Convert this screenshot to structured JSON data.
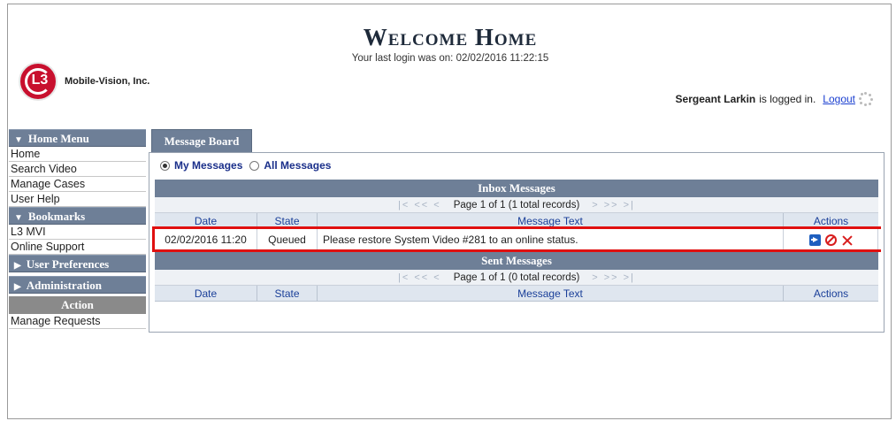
{
  "header": {
    "company": "Mobile-Vision, Inc.",
    "logo_text": "L3",
    "title": "Welcome Home",
    "last_login": "Your last login was on: 02/02/2016 11:22:15",
    "user_name": "Sergeant Larkin",
    "logged_in_suffix": "is logged in.",
    "logout_label": "Logout"
  },
  "sidebar": {
    "home_menu": {
      "title": "Home Menu",
      "items": [
        "Home",
        "Search Video",
        "Manage Cases",
        "User Help"
      ]
    },
    "bookmarks": {
      "title": "Bookmarks",
      "items": [
        "L3 MVI",
        "Online Support"
      ]
    },
    "user_preferences": "User Preferences",
    "administration": "Administration",
    "action": {
      "title": "Action",
      "items": [
        "Manage Requests"
      ]
    }
  },
  "main": {
    "tab_label": "Message Board",
    "filters": {
      "my_messages": "My Messages",
      "all_messages": "All Messages",
      "selected": "my_messages"
    },
    "inbox": {
      "title": "Inbox Messages",
      "pager_text": "Page 1 of 1 (1 total records)",
      "nav_prev": "|< << <",
      "nav_next": "> >> >|",
      "columns": [
        "Date",
        "State",
        "Message Text",
        "Actions"
      ],
      "rows": [
        {
          "date": "02/02/2016 11:20",
          "state": "Queued",
          "message": "Please restore System Video #281 to an online status.",
          "actions": [
            "forward-icon",
            "cancel-icon",
            "delete-icon"
          ]
        }
      ]
    },
    "sent": {
      "title": "Sent Messages",
      "pager_text": "Page 1 of 1 (0 total records)",
      "nav_prev": "|< << <",
      "nav_next": "> >> >|",
      "columns": [
        "Date",
        "State",
        "Message Text",
        "Actions"
      ],
      "rows": []
    }
  },
  "colors": {
    "header_bar": "#6e7f97",
    "highlight": "#e01010",
    "link": "#1a3fd0"
  }
}
